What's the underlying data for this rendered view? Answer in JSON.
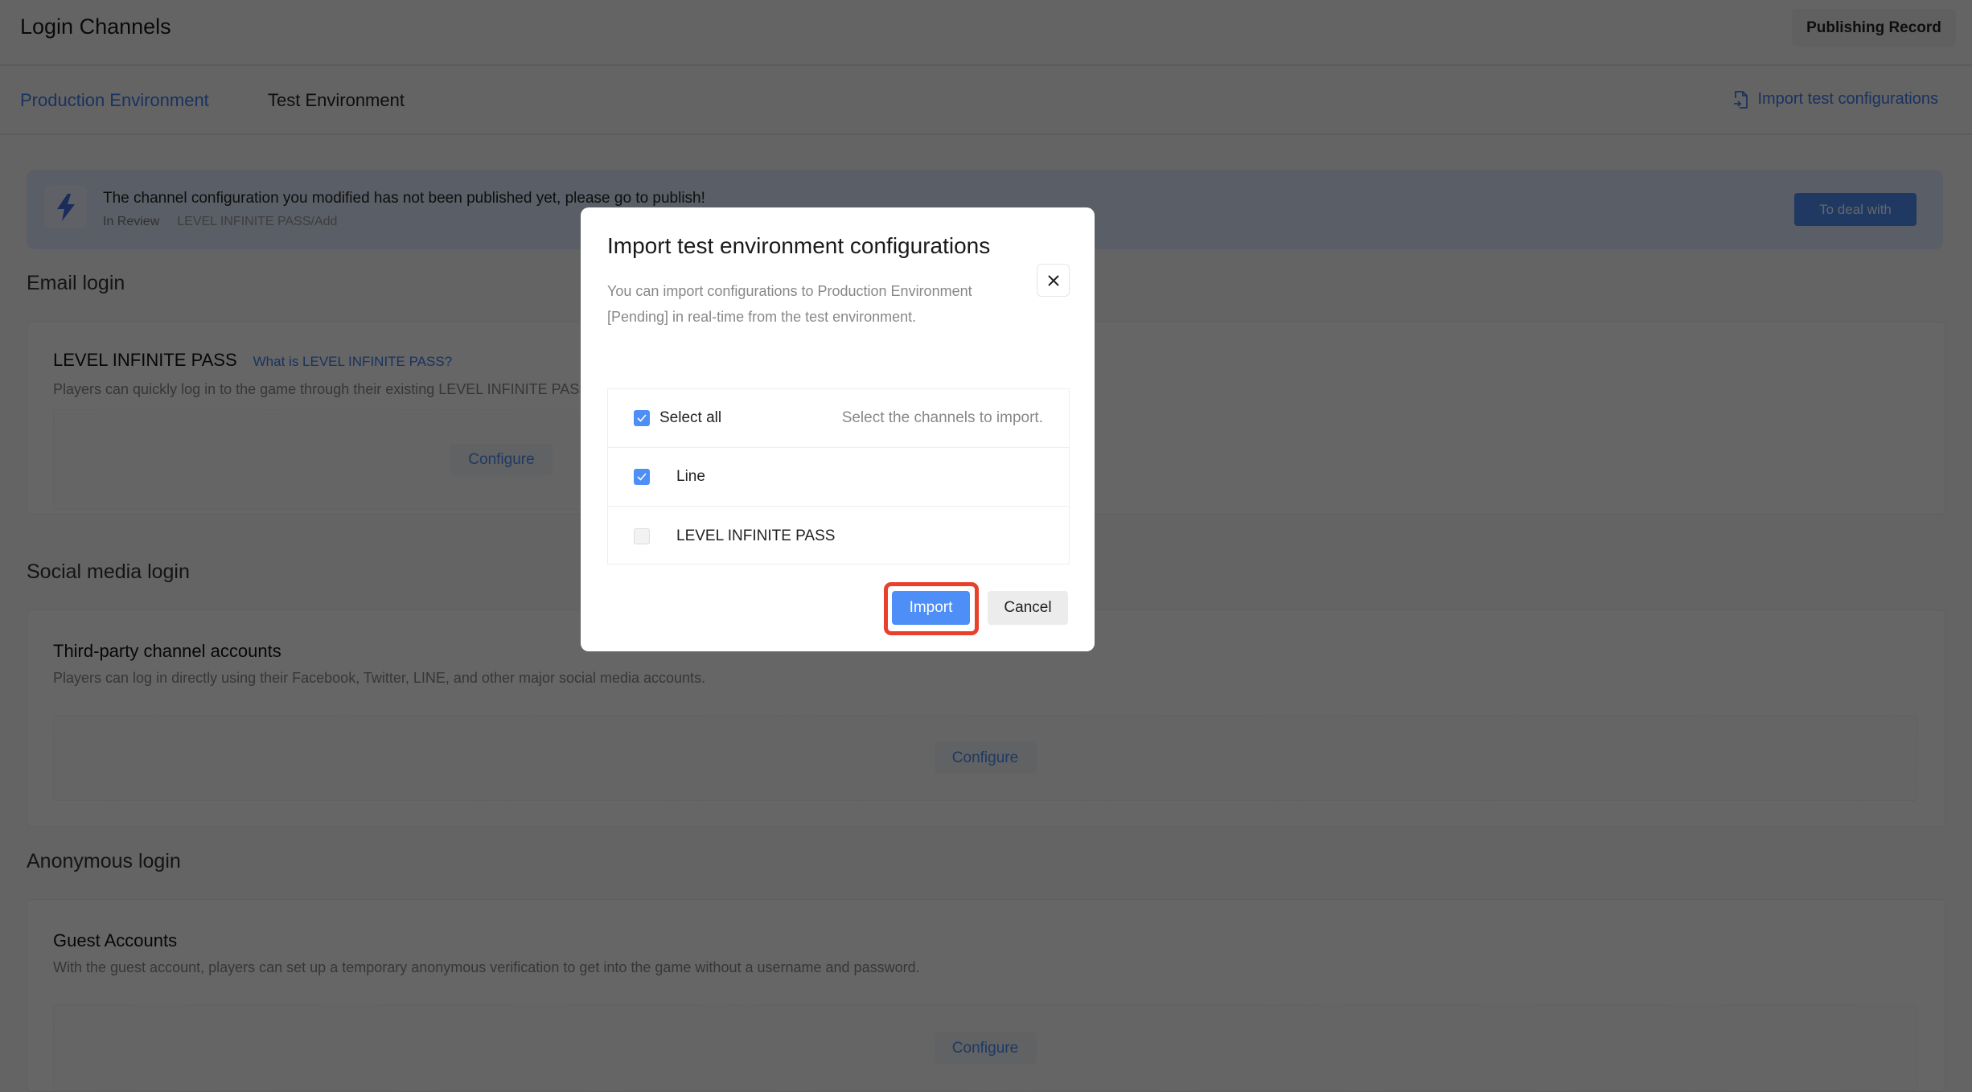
{
  "header": {
    "title": "Login Channels",
    "publishing_record": "Publishing Record"
  },
  "tabs": [
    {
      "label": "Production Environment",
      "active": true
    },
    {
      "label": "Test Environment",
      "active": false
    }
  ],
  "import_link": {
    "label": "Import test configurations",
    "icon": "file-import-icon"
  },
  "banner": {
    "icon": "lightning-icon",
    "message": "The channel configuration you modified has not been published yet, please go to publish!",
    "status": "In Review",
    "detail": "LEVEL INFINITE PASS/Add",
    "button": "To deal with"
  },
  "sections": [
    {
      "heading": "Email login",
      "card_title": "LEVEL INFINITE PASS",
      "card_link": "What is LEVEL INFINITE PASS?",
      "card_desc": "Players can quickly log in to the game through their existing LEVEL INFINITE PASS",
      "configure": "Configure"
    },
    {
      "heading": "Social media login",
      "card_title": "Third-party channel accounts",
      "card_desc": "Players can log in directly using their Facebook, Twitter, LINE, and other major social media accounts.",
      "configure": "Configure"
    },
    {
      "heading": "Anonymous login",
      "card_title": "Guest Accounts",
      "card_desc": "With the guest account, players can set up a temporary anonymous verification to get into the game without a username and password.",
      "configure": "Configure"
    }
  ],
  "modal": {
    "title": "Import test environment configurations",
    "description": "You can import configurations to Production Environment [Pending] in real-time from the test environment.",
    "select_all": {
      "label": "Select all",
      "checked": true
    },
    "hint": "Select the channels to import.",
    "channels": [
      {
        "label": "Line",
        "checked": true
      },
      {
        "label": "LEVEL INFINITE PASS",
        "checked": false
      }
    ],
    "import_button": "Import",
    "cancel_button": "Cancel"
  },
  "colors": {
    "accent": "#4e8ff7",
    "highlight": "#e8402b"
  }
}
